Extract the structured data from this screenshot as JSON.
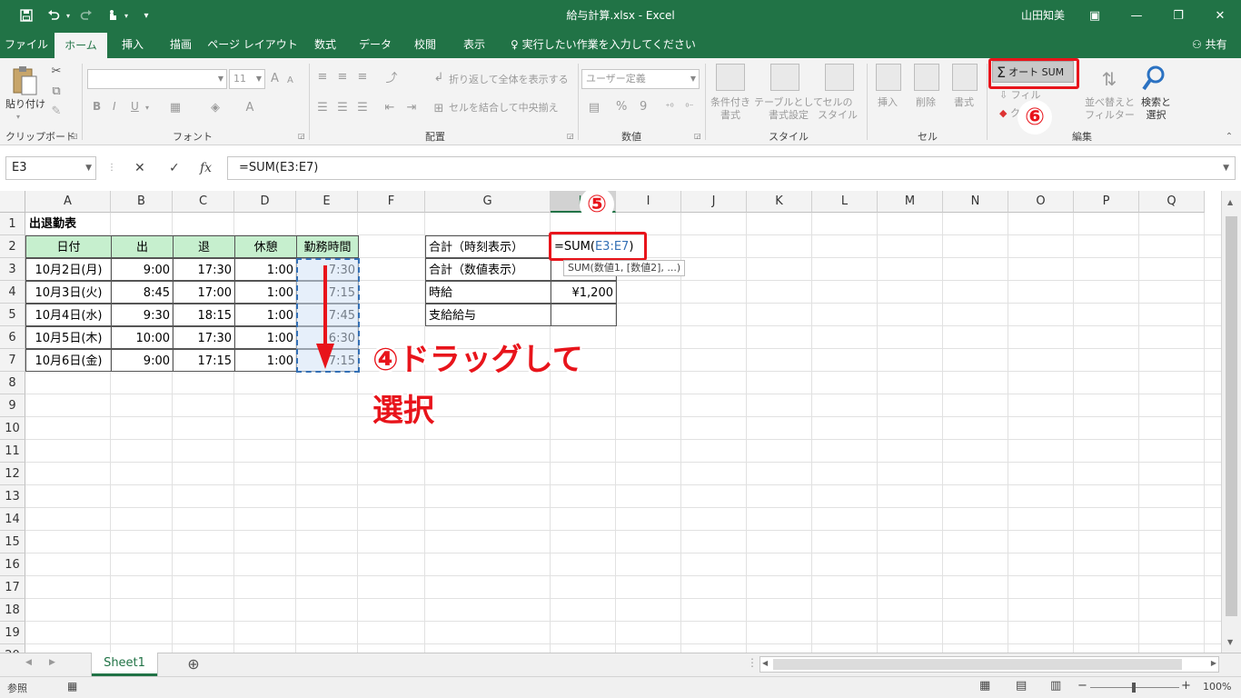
{
  "window": {
    "title": "給与計算.xlsx  -  Excel",
    "user": "山田知美",
    "qa_save_icon": "save-icon",
    "qa_undo_icon": "undo-icon",
    "qa_redo_icon": "redo-icon",
    "qa_touch_icon": "touch-mode-icon",
    "qa_customize_icon": "customize-icon",
    "minimize": "—",
    "restore": "❐",
    "close": "✕",
    "ribbon_display": "▣"
  },
  "tabs": [
    "ファイル",
    "ホーム",
    "挿入",
    "描画",
    "ページ レイアウト",
    "数式",
    "データ",
    "校閲",
    "表示"
  ],
  "tell_me": "実行したい作業を入力してください",
  "share": "共有",
  "ribbon": {
    "clipboard": {
      "paste": "貼り付け",
      "label": "クリップボード"
    },
    "font": {
      "size": "11",
      "label": "フォント",
      "bold": "B",
      "italic": "I",
      "underline": "U",
      "grow": "A",
      "shrink": "A"
    },
    "alignment": {
      "wrap": "折り返して全体を表示する",
      "merge": "セルを結合して中央揃え",
      "label": "配置"
    },
    "number": {
      "format": "ユーザー定義",
      "percent": "%",
      "comma": "9",
      "label": "数値"
    },
    "styles": {
      "conditional": "条件付き\n書式",
      "table": "テーブルとして\n書式設定",
      "cell": "セルの\nスタイル",
      "label": "スタイル"
    },
    "cells": {
      "insert": "挿入",
      "delete": "削除",
      "format": "書式",
      "label": "セル"
    },
    "editing": {
      "autosum": "オート SUM",
      "fill": "フィル",
      "clear": "ク",
      "sort": "並べ替えと\nフィルター",
      "find": "検索と\n選択",
      "label": "編集"
    }
  },
  "formula_bar": {
    "name_box": "E3",
    "cancel": "✕",
    "enter": "✓",
    "fx": "fx",
    "formula": "=SUM(E3:E7)"
  },
  "columns": [
    "A",
    "B",
    "C",
    "D",
    "E",
    "F",
    "G",
    "H",
    "I",
    "J",
    "K",
    "L",
    "M",
    "N",
    "O",
    "P",
    "Q"
  ],
  "rows": [
    "1",
    "2",
    "3",
    "4",
    "5",
    "6",
    "7",
    "8",
    "9",
    "10",
    "11",
    "12",
    "13",
    "14",
    "15",
    "16",
    "17",
    "18",
    "19",
    "20"
  ],
  "sheet": {
    "title": "出退勤表",
    "headers": [
      "日付",
      "出",
      "退",
      "休憩",
      "勤務時間"
    ],
    "records": [
      [
        "10月2日(月)",
        "9:00",
        "17:30",
        "1:00",
        "7:30"
      ],
      [
        "10月3日(火)",
        "8:45",
        "17:00",
        "1:00",
        "7:15"
      ],
      [
        "10月4日(水)",
        "9:30",
        "18:15",
        "1:00",
        "7:45"
      ],
      [
        "10月5日(木)",
        "10:00",
        "17:30",
        "1:00",
        "6:30"
      ],
      [
        "10月6日(金)",
        "9:00",
        "17:15",
        "1:00",
        "7:15"
      ]
    ],
    "summary_labels": [
      "合計（時刻表示）",
      "合計（数値表示）",
      "時給",
      "支給給与"
    ],
    "summary_values": [
      "",
      "",
      "¥1,200",
      ""
    ],
    "edit_prefix": "=SUM(",
    "edit_ref": "E3:E7",
    "edit_suffix": ")",
    "tooltip": "SUM(数値1, [数値2], ...)"
  },
  "annotations": {
    "step4": "④ドラッグして",
    "step4_line2": "選択",
    "step5": "⑤",
    "step6": "⑥"
  },
  "sheet_tab": "Sheet1",
  "add_sheet": "⊕",
  "status": {
    "mode": "参照",
    "zoom": "100%",
    "minus": "−",
    "plus": "+"
  }
}
